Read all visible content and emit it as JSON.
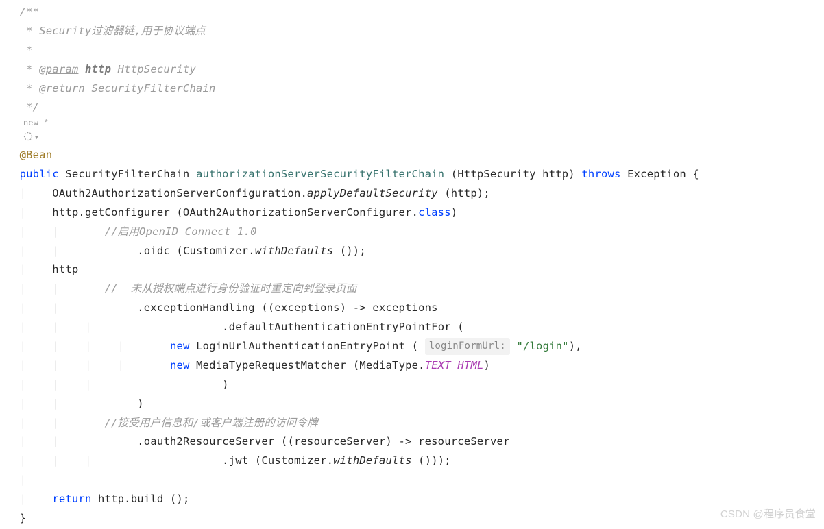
{
  "doc": {
    "open": "/**",
    "l1": " * Security过滤器链,用于协议端点",
    "l2": " *",
    "l3_pre": " * ",
    "l3_tag": "@param",
    "l3_name": " http ",
    "l3_type": "HttpSecurity",
    "l4_pre": " * ",
    "l4_tag": "@return",
    "l4_rest": " SecurityFilterChain",
    "close": " */"
  },
  "gutter": {
    "newmark": "new *",
    "chev": "▾"
  },
  "anno": "@Bean",
  "sig": {
    "kw_public": "public",
    "ret": " SecurityFilterChain ",
    "name": "authorizationServerSecurityFilterChain",
    "params_open": " (HttpSecurity http) ",
    "kw_throws": "throws",
    "exc": " Exception {"
  },
  "l_cfg": {
    "pre": "    OAuth2AuthorizationServerConfiguration.",
    "call": "applyDefaultSecurity",
    "post": " (http);"
  },
  "l_getc": "    http.getConfigurer (OAuth2AuthorizationServerConfigurer.",
  "kw_class": "class",
  "l_getc_close": ")",
  "cmt_oidc": "//启用OpenID Connect 1.0",
  "l_oidc_pre": "            .oidc (Customizer.",
  "l_oidc_call": "withDefaults",
  "l_oidc_post": " ());",
  "l_http": "    http",
  "cmt_redirect": "//  未从授权端点进行身份验证时重定向到登录页面",
  "l_exh": "            .exceptionHandling ((exceptions) -> exceptions",
  "l_defentry": "                    .defaultAuthenticationEntryPointFor (",
  "kw_new": "new",
  "l_login_pre": " LoginUrlAuthenticationEntryPoint ( ",
  "inlay_login": "loginFormUrl:",
  "l_login_str": " \"/login\"",
  "l_login_post": "),",
  "l_media_pre": " MediaTypeRequestMatcher (MediaType.",
  "l_media_const": "TEXT_HTML",
  "l_media_post": ")",
  "l_paren1": "                    )",
  "l_paren2": "            )",
  "cmt_token": "//接受用户信息和/或客户端注册的访问令牌",
  "l_rs": "            .oauth2ResourceServer ((resourceServer) -> resourceServer",
  "l_jwt_pre": "                    .jwt (Customizer.",
  "l_jwt_call": "withDefaults",
  "l_jwt_post": " ()));",
  "l_return_kw": "return",
  "l_return_rest": " http.build ();",
  "l_close": "}",
  "watermark": "CSDN @程序员食堂"
}
